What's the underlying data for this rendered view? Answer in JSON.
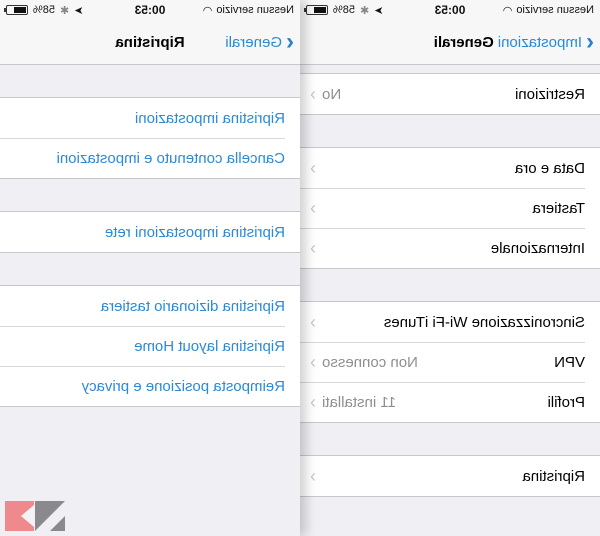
{
  "status_bar": {
    "carrier": "Nessun servizio",
    "time": "00:53",
    "battery": "58%",
    "battery_level": 0.58
  },
  "colors": {
    "accent": "#2a8ad8",
    "background": "#efeff4",
    "secondary_text": "#8e8e93"
  },
  "generali": {
    "back_label": "Impostazioni",
    "title": "Generali",
    "groups": [
      [
        {
          "label": "Restrizioni",
          "value": "No"
        }
      ],
      [
        {
          "label": "Data e ora",
          "value": ""
        },
        {
          "label": "Tastiera",
          "value": ""
        },
        {
          "label": "Internazionale",
          "value": ""
        }
      ],
      [
        {
          "label": "Sincronizzazione Wi-Fi iTunes",
          "value": ""
        },
        {
          "label": "VPN",
          "value": "Non connesso"
        },
        {
          "label": "Profili",
          "value": "11 installati"
        }
      ],
      [
        {
          "label": "Ripristina",
          "value": ""
        }
      ]
    ]
  },
  "ripristina": {
    "back_label": "Generali",
    "title": "Ripristina",
    "groups": [
      [
        {
          "label": "Ripristina impostazioni"
        },
        {
          "label": "Cancella contenuto e impostazioni"
        }
      ],
      [
        {
          "label": "Ripristina impostazioni rete"
        }
      ],
      [
        {
          "label": "Ripristina dizionario tastiera"
        },
        {
          "label": "Ripristina layout Home"
        },
        {
          "label": "Reimposta posizione e privacy"
        }
      ]
    ]
  },
  "icons": {
    "wifi": "wifi-icon",
    "location": "location-arrow-icon",
    "bluetooth": "bluetooth-icon",
    "battery": "battery-icon",
    "back": "chevron-left-icon",
    "disclosure": "chevron-right-icon"
  }
}
